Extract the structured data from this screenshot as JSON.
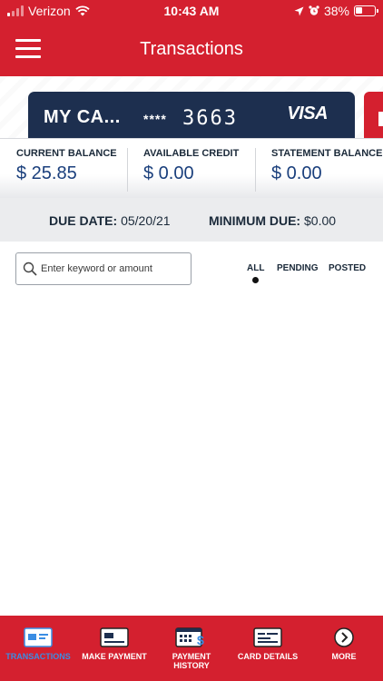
{
  "status_bar": {
    "carrier": "Verizon",
    "time": "10:43 AM",
    "battery": "38%"
  },
  "header": {
    "title": "Transactions"
  },
  "card": {
    "name": "MY CA...",
    "masked": "****",
    "last4": "3663",
    "brand": "VISA"
  },
  "balances": [
    {
      "label": "CURRENT BALANCE",
      "value": "$ 25.85"
    },
    {
      "label": "AVAILABLE CREDIT",
      "value": "$ 0.00"
    },
    {
      "label": "STATEMENT BALANCE",
      "value": "$ 0.00"
    }
  ],
  "due": {
    "due_date_label": "DUE DATE:",
    "due_date_value": "05/20/21",
    "min_due_label": "MINIMUM DUE:",
    "min_due_value": "$0.00"
  },
  "search": {
    "placeholder": "Enter keyword or amount"
  },
  "filters": {
    "all": "ALL",
    "pending": "PENDING",
    "posted": "POSTED",
    "selected": "ALL"
  },
  "tabs": [
    {
      "label": "TRANSACTIONS",
      "icon": "transactions-icon",
      "active": true
    },
    {
      "label": "MAKE PAYMENT",
      "icon": "make-payment-icon",
      "active": false
    },
    {
      "label": "PAYMENT HISTORY",
      "icon": "payment-history-icon",
      "active": false
    },
    {
      "label": "CARD DETAILS",
      "icon": "card-details-icon",
      "active": false
    },
    {
      "label": "MORE",
      "icon": "more-icon",
      "active": false
    }
  ],
  "colors": {
    "brand_red": "#d4202f",
    "card_navy": "#1d2f4f",
    "value_blue": "#1a3f7c",
    "active_tab": "#3b8de3"
  }
}
